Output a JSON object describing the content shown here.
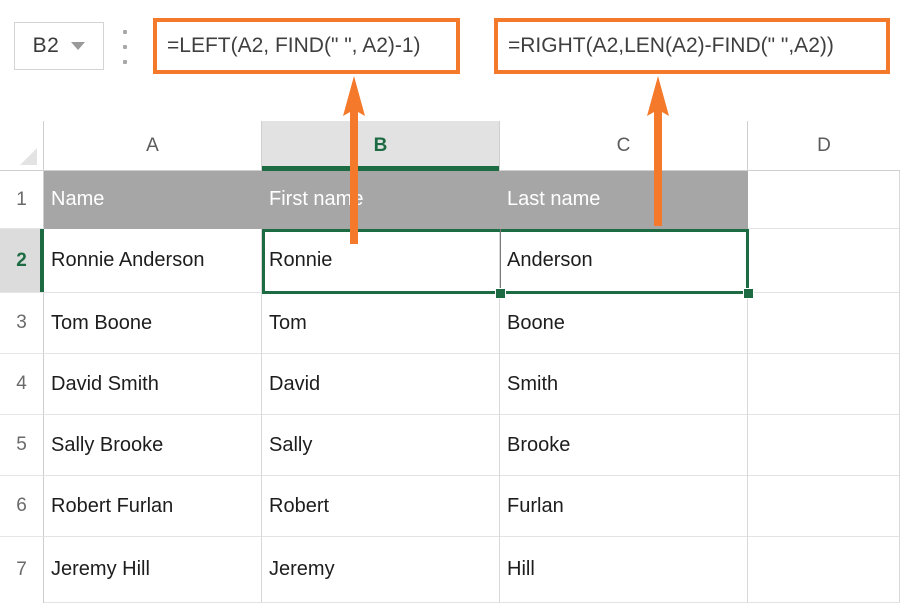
{
  "app": {
    "type": "spreadsheet",
    "accent_orange": "#F4792B",
    "selection_green": "#1D6B42",
    "header_row_gray": "#A6A6A6",
    "col_header_selected_gray": "#E2E2E2"
  },
  "name_box": {
    "value": "B2",
    "dropdown_icon": "chevron-down-icon",
    "separator_icon": "vertical-dots-icon"
  },
  "formula_bars": [
    {
      "id": "formula-b",
      "cell": "B2",
      "value": "=LEFT(A2, FIND(\" \", A2)-1)",
      "highlight": "#F4792B"
    },
    {
      "id": "formula-c",
      "cell": "C2",
      "value": "=RIGHT(A2,LEN(A2)-FIND(\" \",A2))",
      "highlight": "#F4792B"
    }
  ],
  "grid": {
    "select_all_icon": "select-all-triangle-icon",
    "columns": [
      {
        "label": "A",
        "selected": false
      },
      {
        "label": "B",
        "selected": true
      },
      {
        "label": "C",
        "selected": false
      },
      {
        "label": "D",
        "selected": false
      }
    ],
    "rows": [
      {
        "number": "1",
        "selected": false,
        "is_header": true,
        "cells": [
          "Name",
          "First name",
          "Last name",
          ""
        ]
      },
      {
        "number": "2",
        "selected": true,
        "is_header": false,
        "cells": [
          "Ronnie Anderson",
          "Ronnie",
          "Anderson",
          ""
        ]
      },
      {
        "number": "3",
        "selected": false,
        "is_header": false,
        "cells": [
          "Tom Boone",
          "Tom",
          "Boone",
          ""
        ]
      },
      {
        "number": "4",
        "selected": false,
        "is_header": false,
        "cells": [
          "David Smith",
          "David",
          "Smith",
          ""
        ]
      },
      {
        "number": "5",
        "selected": false,
        "is_header": false,
        "cells": [
          "Sally Brooke",
          "Sally",
          "Brooke",
          ""
        ]
      },
      {
        "number": "6",
        "selected": false,
        "is_header": false,
        "cells": [
          "Robert Furlan",
          "Robert",
          "Furlan",
          ""
        ]
      },
      {
        "number": "7",
        "selected": false,
        "is_header": false,
        "cells": [
          "Jeremy Hill",
          "Jeremy",
          "Hill",
          ""
        ]
      }
    ],
    "selected_range": "B2:C2"
  },
  "annotations": [
    {
      "id": "arrow-to-formula-b",
      "icon": "up-arrow-annotation",
      "points_to": "formula-b",
      "color": "#F4792B"
    },
    {
      "id": "arrow-to-formula-c",
      "icon": "up-arrow-annotation",
      "points_to": "formula-c",
      "color": "#F4792B"
    }
  ]
}
